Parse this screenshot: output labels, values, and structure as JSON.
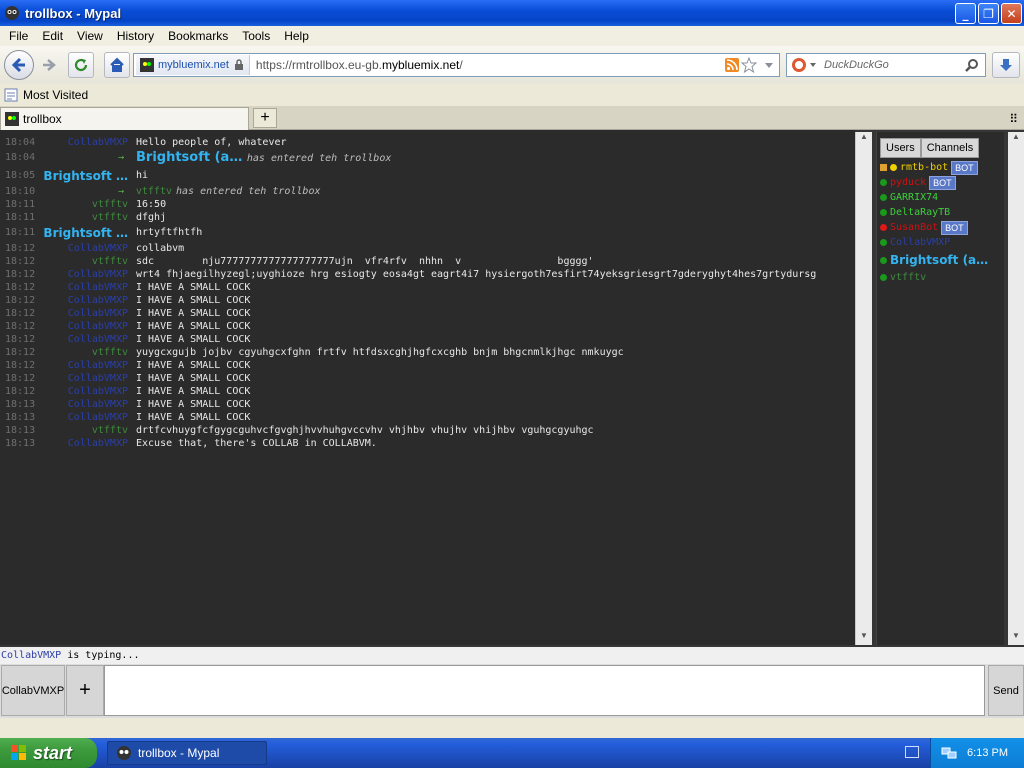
{
  "window": {
    "title": "trollbox - Mypal",
    "minimize": "_",
    "maximize": "❐",
    "close": "✕"
  },
  "menu": [
    "File",
    "Edit",
    "View",
    "History",
    "Bookmarks",
    "Tools",
    "Help"
  ],
  "nav": {
    "site_identity": "mybluemix.net",
    "url_prefix": "https://rmtrollbox.eu-gb.",
    "url_domain": "mybluemix.net",
    "url_suffix": "/",
    "search_placeholder": "DuckDuckGo"
  },
  "bookmarks": {
    "most_visited": "Most Visited"
  },
  "tabs": [
    {
      "label": "trollbox"
    }
  ],
  "chat": {
    "messages": [
      {
        "time": "18:04",
        "nick": "CollabVMXP",
        "nick_style": "blue",
        "text": "Hello people of, whatever"
      },
      {
        "time": "18:04",
        "arrow": "→",
        "join_nick": "Brightsoft (a…",
        "text": "has entered teh trollbox",
        "tall": true
      },
      {
        "time": "18:05",
        "nick": "Brightsoft …",
        "nick_style": "bigcyan",
        "text": "hi",
        "tall": true
      },
      {
        "time": "18:10",
        "arrow": "→",
        "join_small": "vtfftv",
        "text": "has entered teh trollbox"
      },
      {
        "time": "18:11",
        "nick": "vtfftv",
        "nick_style": "green",
        "text": "16:50"
      },
      {
        "time": "18:11",
        "nick": "vtfftv",
        "nick_style": "green",
        "text": "dfghj"
      },
      {
        "time": "18:11",
        "nick": "Brightsoft …",
        "nick_style": "bigcyan",
        "text": "hrtyftfhtfh",
        "tall": true
      },
      {
        "time": "18:12",
        "nick": "CollabVMXP",
        "nick_style": "blue",
        "text": "collabvm"
      },
      {
        "time": "18:12",
        "nick": "vtfftv",
        "nick_style": "green",
        "text": "sdc        nju7777777777777777777ujn  vfr4rfv  nhhn  v                bgggg'"
      },
      {
        "time": "18:12",
        "nick": "CollabVMXP",
        "nick_style": "blue",
        "text": "wrt4 fhjaegilhyzegl;uyghioze hrg esiogty eosa4gt eagrt4i7 hysiergoth7esfirt74yeksgriesgrt7gderyghyt4hes7grtydursg"
      },
      {
        "time": "18:12",
        "nick": "CollabVMXP",
        "nick_style": "blue",
        "text": "I HAVE A SMALL COCK"
      },
      {
        "time": "18:12",
        "nick": "CollabVMXP",
        "nick_style": "blue",
        "text": "I HAVE A SMALL COCK"
      },
      {
        "time": "18:12",
        "nick": "CollabVMXP",
        "nick_style": "blue",
        "text": "I HAVE A SMALL COCK"
      },
      {
        "time": "18:12",
        "nick": "CollabVMXP",
        "nick_style": "blue",
        "text": "I HAVE A SMALL COCK"
      },
      {
        "time": "18:12",
        "nick": "CollabVMXP",
        "nick_style": "blue",
        "text": "I HAVE A SMALL COCK"
      },
      {
        "time": "18:12",
        "nick": "vtfftv",
        "nick_style": "green",
        "text": "yuygcxgujb jojbv cgyuhgcxfghn frtfv htfdsxcghjhgfcxcghb bnjm bhgcnmlkjhgc nmkuygc"
      },
      {
        "time": "18:12",
        "nick": "CollabVMXP",
        "nick_style": "blue",
        "text": "I HAVE A SMALL COCK"
      },
      {
        "time": "18:12",
        "nick": "CollabVMXP",
        "nick_style": "blue",
        "text": "I HAVE A SMALL COCK"
      },
      {
        "time": "18:12",
        "nick": "CollabVMXP",
        "nick_style": "blue",
        "text": "I HAVE A SMALL COCK"
      },
      {
        "time": "18:13",
        "nick": "CollabVMXP",
        "nick_style": "blue",
        "text": "I HAVE A SMALL COCK"
      },
      {
        "time": "18:13",
        "nick": "CollabVMXP",
        "nick_style": "blue",
        "text": "I HAVE A SMALL COCK"
      },
      {
        "time": "18:13",
        "nick": "vtfftv",
        "nick_style": "green",
        "text": "drtfcvhuygfcfgygcguhvcfgvghjhvvhuhgvccvhv vhjhbv vhujhv vhijhbv vguhgcgyuhgc"
      },
      {
        "time": "18:13",
        "nick": "CollabVMXP",
        "nick_style": "blue",
        "text": "Excuse that, there's COLLAB in COLLABVM."
      }
    ]
  },
  "sidebar": {
    "tabs": [
      "Users",
      "Channels"
    ],
    "users": [
      {
        "name": "rmtb-bot",
        "color": "#f0d000",
        "dot": "#f0d000",
        "bot": true,
        "crown": true
      },
      {
        "name": "pyduck",
        "color": "#d01010",
        "dot": "#1a9a1a",
        "bot": true
      },
      {
        "name": "GARRIX74",
        "color": "#3cd03c",
        "dot": "#1a9a1a"
      },
      {
        "name": "DeltaRayTB",
        "color": "#3cd03c",
        "dot": "#1a9a1a"
      },
      {
        "name": "SusanBot",
        "color": "#d01010",
        "dot": "#e01818",
        "bot": true
      },
      {
        "name": "CollabVMXP",
        "color": "#2b3fa8",
        "dot": "#1a9a1a"
      },
      {
        "name": "Brightsoft (a…",
        "color": "#33b3f0",
        "dot": "#1a9a1a",
        "big": true
      },
      {
        "name": "vtfftv",
        "color": "#3f8a3f",
        "dot": "#1a9a1a"
      }
    ],
    "bot_label": "BOT"
  },
  "typing": {
    "nick": "CollabVMXP",
    "text": " is typing..."
  },
  "input": {
    "nick_button": "CollabVMXP",
    "plus": "+",
    "send": "Send",
    "value": ""
  },
  "taskbar": {
    "start": "start",
    "task_label": "trollbox - Mypal",
    "clock": "6:13 PM"
  }
}
